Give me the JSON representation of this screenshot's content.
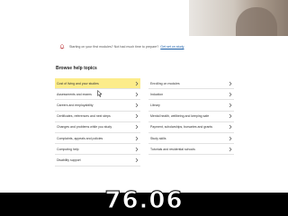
{
  "notice": {
    "text": "Starting on your first modules? Not had much time to prepare?",
    "link": "Get set on study"
  },
  "help": {
    "heading": "Browse help topics",
    "left": [
      "Cost of living and your studies",
      "Assessments and exams",
      "Careers and employability",
      "Certificates, references and next steps",
      "Changes and problems while you study",
      "Complaints, appeals and policies",
      "Computing help",
      "Disability support"
    ],
    "right": [
      "Enrolling on modules",
      "Induction",
      "Library",
      "Mental health, wellbeing and keeping safe",
      "Payment, scholarships, bursaries and grants",
      "Study skills",
      "Tutorials and residential schools"
    ]
  },
  "overlay": {
    "timer": "76.06"
  },
  "colors": {
    "highlight": "#fcec8a",
    "link": "#1a5ea8",
    "accent": "#b41f24"
  }
}
